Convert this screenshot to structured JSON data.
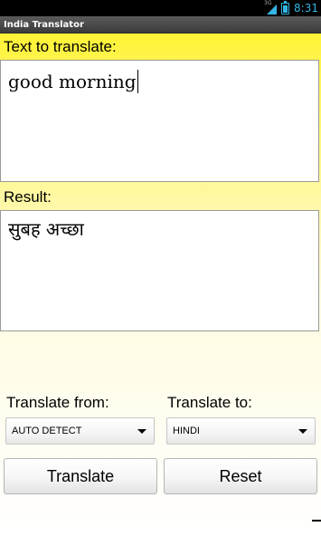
{
  "status_bar": {
    "network": "3G",
    "time": "8:31",
    "accent_color": "#35b5e5"
  },
  "app": {
    "title": "India Translator"
  },
  "input": {
    "label": "Text to translate:",
    "value": "good morning"
  },
  "result": {
    "label": "Result:",
    "value": "सुबह अच्छा"
  },
  "translate_from": {
    "label": "Translate from:",
    "selected": "AUTO DETECT"
  },
  "translate_to": {
    "label": "Translate to:",
    "selected": "HINDI"
  },
  "buttons": {
    "translate": "Translate",
    "reset": "Reset"
  },
  "icons": {
    "signal": "signal-icon",
    "battery": "battery-icon",
    "dropdown": "chevron-down-icon"
  }
}
